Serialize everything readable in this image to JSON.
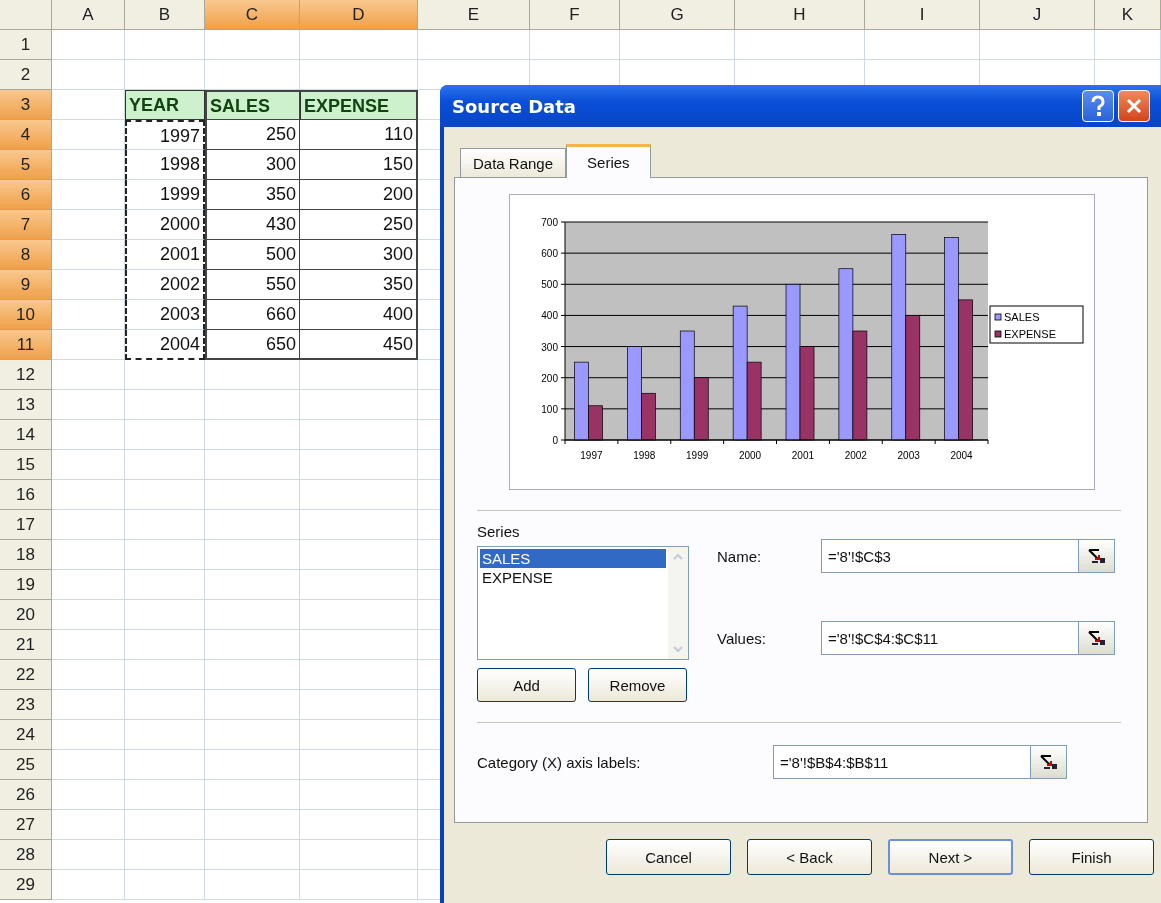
{
  "sheet": {
    "columns": [
      {
        "label": "A",
        "selected": false
      },
      {
        "label": "B",
        "selected": false
      },
      {
        "label": "C",
        "selected": true
      },
      {
        "label": "D",
        "selected": true
      },
      {
        "label": "E",
        "selected": false
      },
      {
        "label": "F",
        "selected": false
      },
      {
        "label": "G",
        "selected": false
      },
      {
        "label": "H",
        "selected": false
      },
      {
        "label": "I",
        "selected": false
      },
      {
        "label": "J",
        "selected": false
      },
      {
        "label": "K",
        "selected": false
      }
    ],
    "rows": [
      {
        "label": "1",
        "selected": false
      },
      {
        "label": "2",
        "selected": false
      },
      {
        "label": "3",
        "selected": true
      },
      {
        "label": "4",
        "selected": true
      },
      {
        "label": "5",
        "selected": true
      },
      {
        "label": "6",
        "selected": true
      },
      {
        "label": "7",
        "selected": true
      },
      {
        "label": "8",
        "selected": true
      },
      {
        "label": "9",
        "selected": true
      },
      {
        "label": "10",
        "selected": true
      },
      {
        "label": "11",
        "selected": true
      },
      {
        "label": "12",
        "selected": false
      },
      {
        "label": "13",
        "selected": false
      },
      {
        "label": "14",
        "selected": false
      },
      {
        "label": "15",
        "selected": false
      },
      {
        "label": "16",
        "selected": false
      },
      {
        "label": "17",
        "selected": false
      },
      {
        "label": "18",
        "selected": false
      },
      {
        "label": "19",
        "selected": false
      },
      {
        "label": "20",
        "selected": false
      },
      {
        "label": "21",
        "selected": false
      },
      {
        "label": "22",
        "selected": false
      },
      {
        "label": "23",
        "selected": false
      },
      {
        "label": "24",
        "selected": false
      },
      {
        "label": "25",
        "selected": false
      },
      {
        "label": "26",
        "selected": false
      },
      {
        "label": "27",
        "selected": false
      },
      {
        "label": "28",
        "selected": false
      },
      {
        "label": "29",
        "selected": false
      }
    ],
    "table": {
      "header": [
        "YEAR",
        "SALES",
        "EXPENSE"
      ],
      "rows": [
        [
          "1997",
          "250",
          "110"
        ],
        [
          "1998",
          "300",
          "150"
        ],
        [
          "1999",
          "350",
          "200"
        ],
        [
          "2000",
          "430",
          "250"
        ],
        [
          "2001",
          "500",
          "300"
        ],
        [
          "2002",
          "550",
          "350"
        ],
        [
          "2003",
          "660",
          "400"
        ],
        [
          "2004",
          "650",
          "450"
        ]
      ]
    }
  },
  "dialog": {
    "title": "Source Data",
    "tabs": [
      {
        "label": "Data Range",
        "selected": false
      },
      {
        "label": "Series",
        "selected": true
      }
    ],
    "chart_data": {
      "type": "bar",
      "categories": [
        "1997",
        "1998",
        "1999",
        "2000",
        "2001",
        "2002",
        "2003",
        "2004"
      ],
      "series": [
        {
          "name": "SALES",
          "color": "#9999ff",
          "values": [
            250,
            300,
            350,
            430,
            500,
            550,
            660,
            650
          ]
        },
        {
          "name": "EXPENSE",
          "color": "#993366",
          "values": [
            110,
            150,
            200,
            250,
            300,
            350,
            400,
            450
          ]
        }
      ],
      "ylim": [
        0,
        700
      ],
      "yticks": [
        {
          "value": 0,
          "label": "0"
        },
        {
          "value": 100,
          "label": "100"
        },
        {
          "value": 200,
          "label": "200"
        },
        {
          "value": 300,
          "label": "300"
        },
        {
          "value": 400,
          "label": "400"
        },
        {
          "value": 500,
          "label": "500"
        },
        {
          "value": 600,
          "label": "600"
        },
        {
          "value": 700,
          "label": "700"
        }
      ],
      "grid": true,
      "legend": true
    },
    "series_label": "Series",
    "series_list": [
      {
        "label": "SALES",
        "selected": true
      },
      {
        "label": "EXPENSE",
        "selected": false
      }
    ],
    "name_field": {
      "label": "Name:",
      "value": "='8'!$C$3"
    },
    "values_field": {
      "label": "Values:",
      "value": "='8'!$C$4:$C$11"
    },
    "add_button": "Add",
    "remove_button": "Remove",
    "category_field": {
      "label": "Category (X) axis labels:",
      "value": "='8'!$B$4:$B$11"
    },
    "buttons": [
      {
        "label": "Cancel",
        "default": false
      },
      {
        "label": "< Back",
        "default": false
      },
      {
        "label": "Next >",
        "default": true
      },
      {
        "label": "Finish",
        "default": false
      }
    ]
  }
}
